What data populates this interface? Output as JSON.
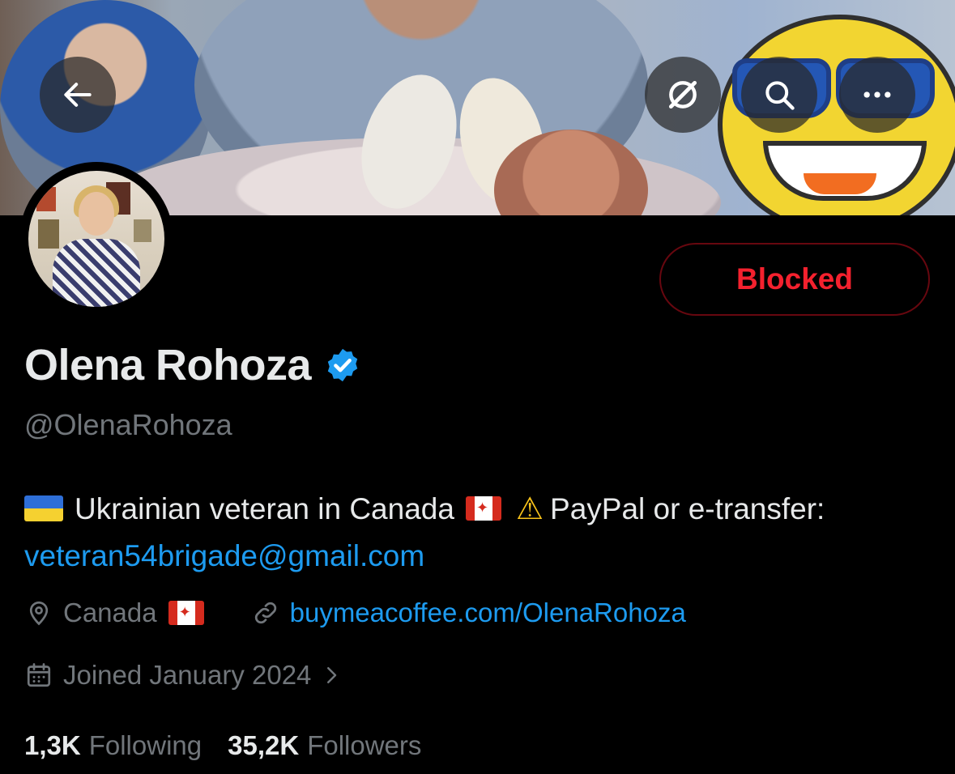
{
  "profile": {
    "name": "Olena Rohoza",
    "handle": "@OlenaRohoza",
    "verified": true,
    "verified_color": "#1d9bf0",
    "bio_text_1": "Ukrainian veteran in Canada",
    "bio_text_2": "PayPal or e-transfer:",
    "bio_email": "veteran54brigade@gmail.com",
    "location": "Canada",
    "website": "buymeacoffee.com/OlenaRohoza",
    "joined": "Joined January 2024",
    "following_count": "1,3K",
    "following_label": "Following",
    "followers_count": "35,2K",
    "followers_label": "Followers"
  },
  "actions": {
    "blocked_label": "Blocked",
    "blocked_color": "#f4212e"
  },
  "icons": {
    "back": "arrow-left-icon",
    "grok": "slash-circle-icon",
    "search": "search-icon",
    "more": "more-horizontal-icon",
    "location": "location-pin-icon",
    "link": "link-icon",
    "calendar": "calendar-icon",
    "chevron": "chevron-right-icon"
  }
}
